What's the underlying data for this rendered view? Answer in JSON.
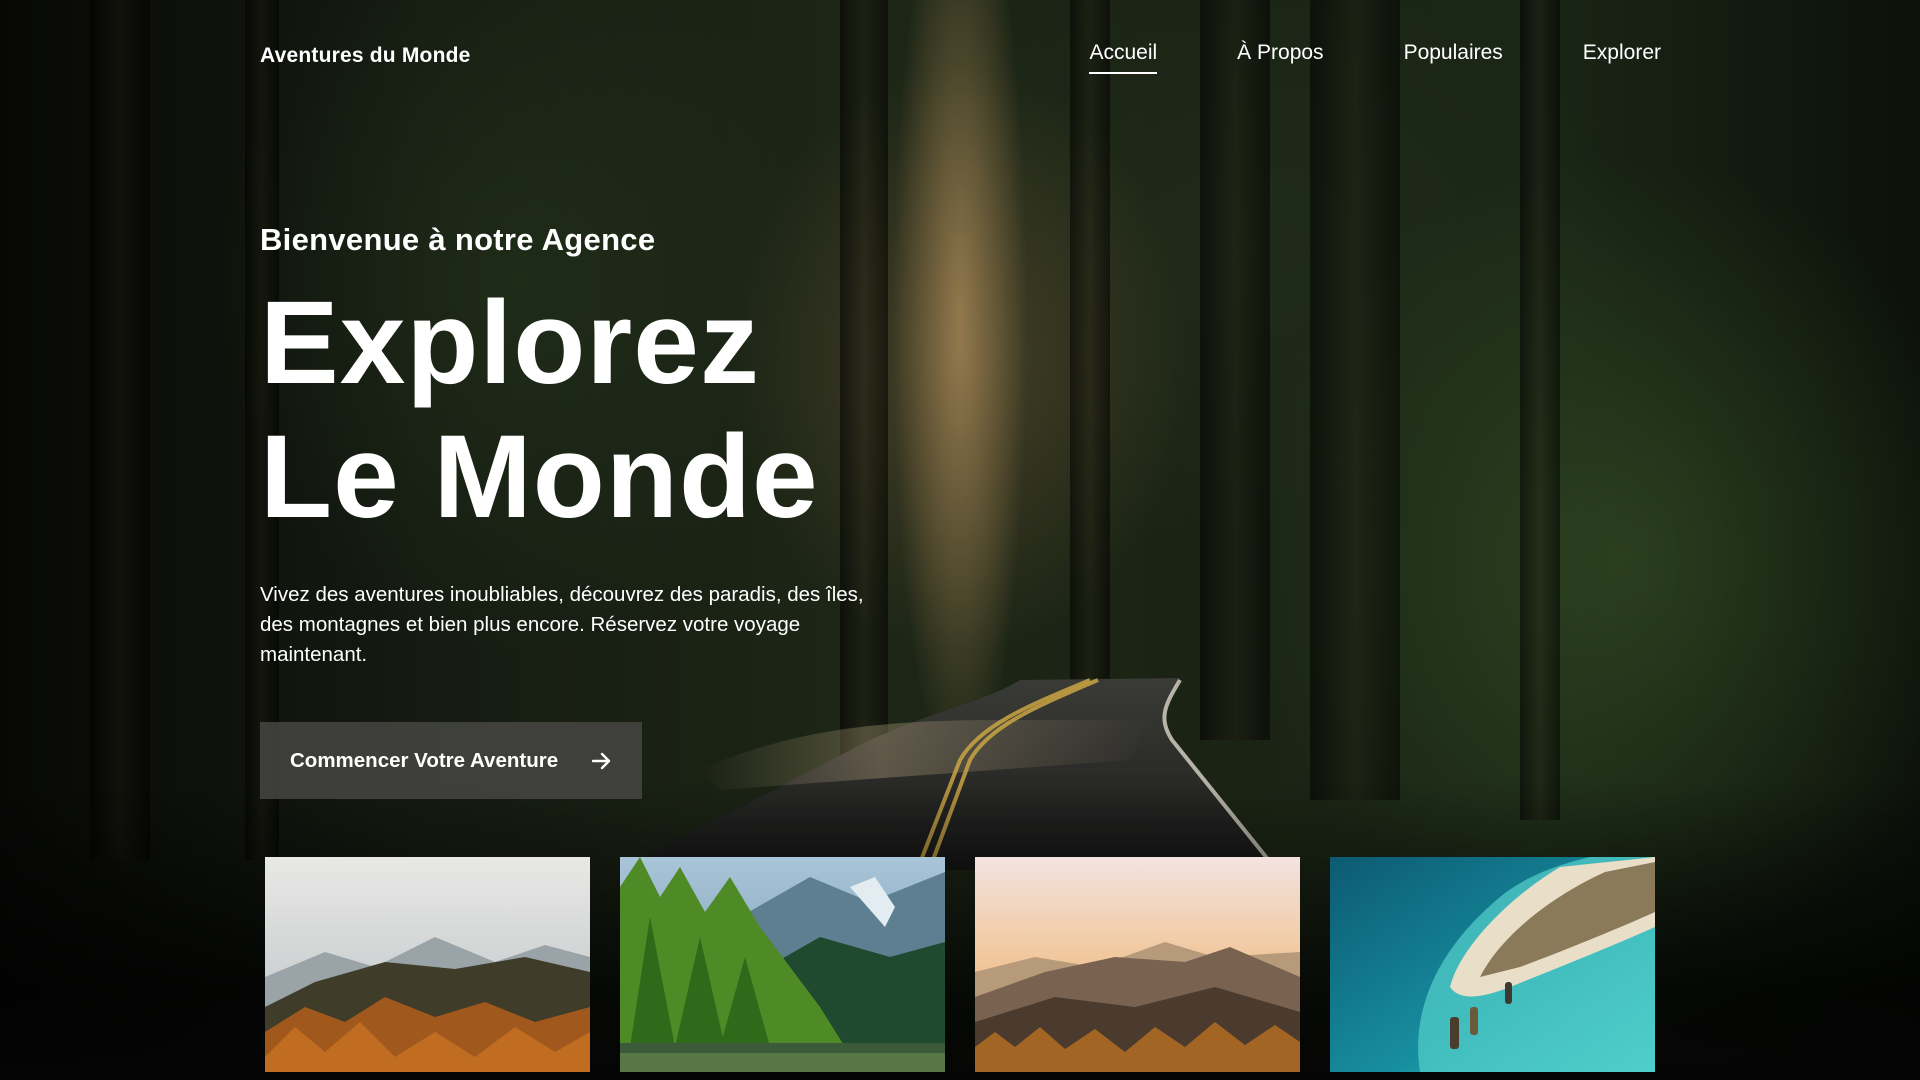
{
  "nav": {
    "brand": "Aventures du Monde",
    "links": [
      {
        "label": "Accueil",
        "active": true
      },
      {
        "label": "À Propos",
        "active": false
      },
      {
        "label": "Populaires",
        "active": false
      },
      {
        "label": "Explorer",
        "active": false
      }
    ]
  },
  "hero": {
    "kicker": "Bienvenue à notre Agence",
    "headline_line1": "Explorez",
    "headline_line2": "Le Monde",
    "description": "Vivez des aventures inoubliables, découvrez des paradis, des îles, des montagnes et bien plus encore. Réservez votre voyage maintenant.",
    "cta_label": "Commencer Votre Aventure",
    "cta_icon": "arrow-right-icon"
  },
  "gallery": [
    {
      "subject": "autumn-mountain-photo"
    },
    {
      "subject": "pine-lake-photo"
    },
    {
      "subject": "sunset-mountain-photo"
    },
    {
      "subject": "tropical-island-photo"
    }
  ],
  "colors": {
    "text": "#ffffff",
    "cta_background": "#484844",
    "background": "#0b0d09"
  }
}
